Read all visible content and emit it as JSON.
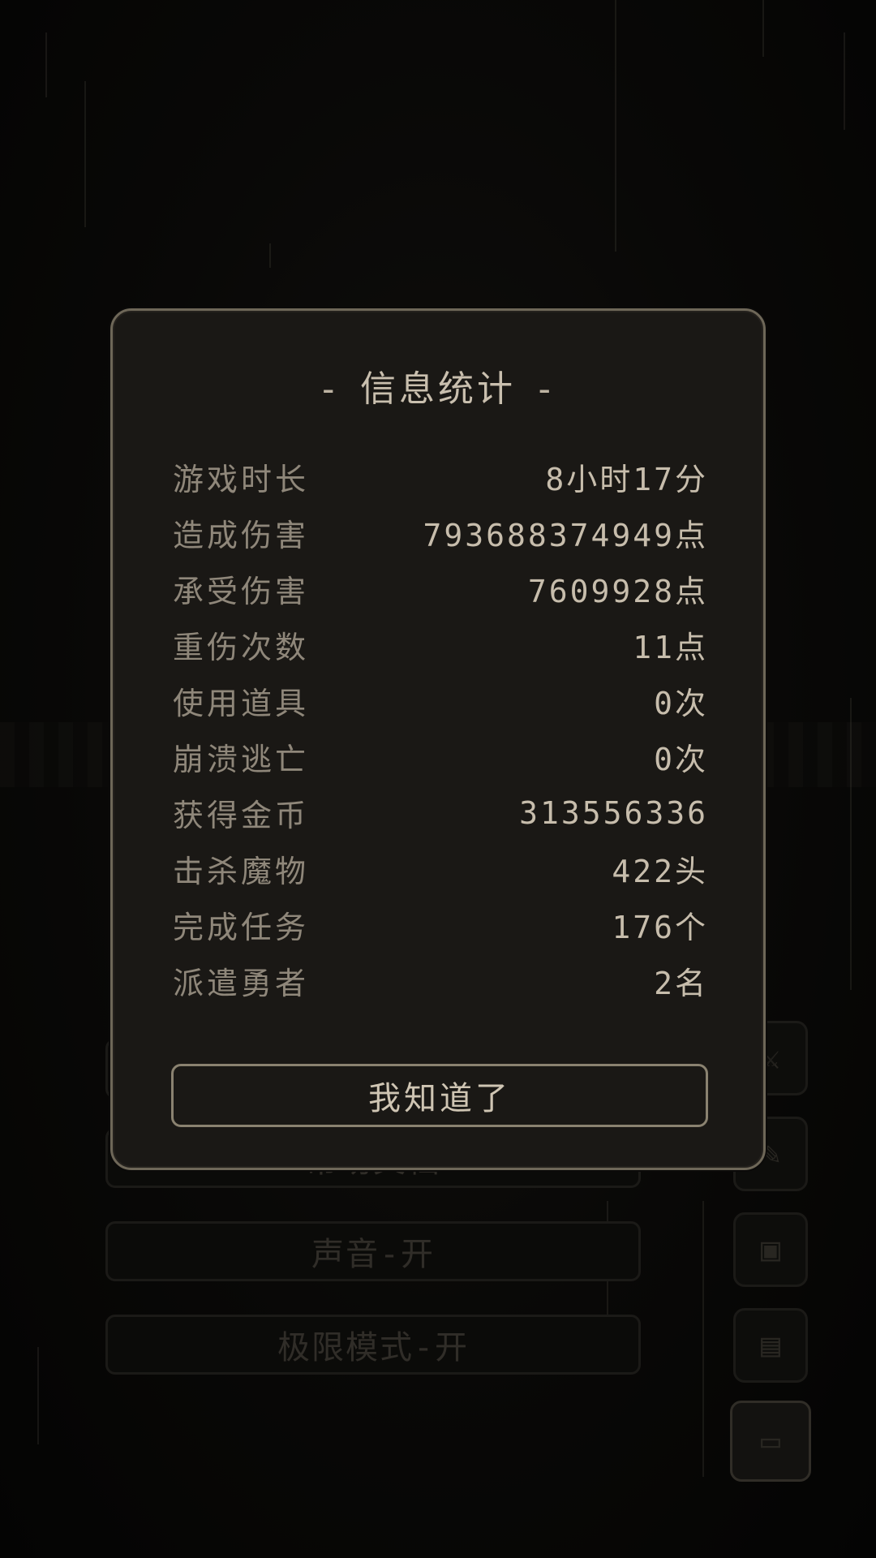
{
  "dialog": {
    "title": "信息统计",
    "title_dash": "-",
    "stats": [
      {
        "label": "游戏时长",
        "value": "8小时17分"
      },
      {
        "label": "造成伤害",
        "value": "793688374949点"
      },
      {
        "label": "承受伤害",
        "value": "7609928点"
      },
      {
        "label": "重伤次数",
        "value": "11点"
      },
      {
        "label": "使用道具",
        "value": "0次"
      },
      {
        "label": "崩溃逃亡",
        "value": "0次"
      },
      {
        "label": "获得金币",
        "value": "313556336"
      },
      {
        "label": "击杀魔物",
        "value": "422头"
      },
      {
        "label": "完成任务",
        "value": "176个"
      },
      {
        "label": "派遣勇者",
        "value": "2名"
      }
    ],
    "confirm_label": "我知道了"
  },
  "background_menu": {
    "buttons": [
      "帮助文档",
      "声音-开",
      "极限模式-开"
    ],
    "icons": [
      "sword-icon",
      "scroll-icon",
      "map-icon",
      "document-icon",
      "computer-icon"
    ]
  },
  "colors": {
    "dialog_bg": "#1a1815",
    "dialog_border": "#6e6758",
    "label_text": "#8f877a",
    "value_text": "#c7bdac"
  }
}
